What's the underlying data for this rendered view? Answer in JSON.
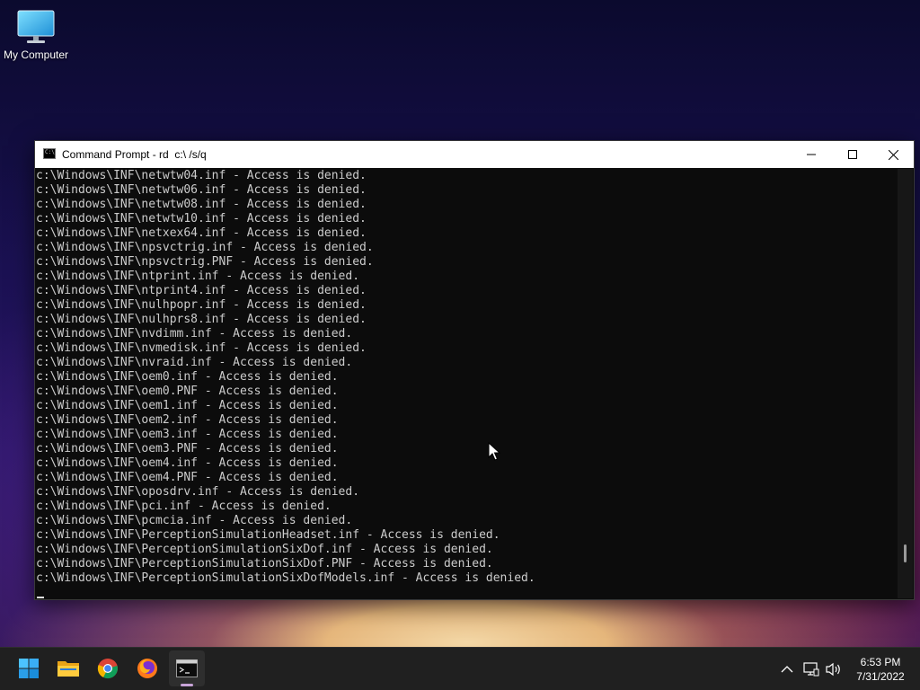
{
  "desktop": {
    "icons": [
      {
        "label": "My Computer",
        "icon": "computer-monitor-icon"
      }
    ]
  },
  "window": {
    "title": "Command Prompt - rd  c:\\ /s/q",
    "icon": "cmd-icon",
    "controls": {
      "minimize": "minimize-icon",
      "maximize": "maximize-icon",
      "close": "close-icon"
    },
    "console_lines": [
      "c:\\Windows\\INF\\netwtw04.inf - Access is denied.",
      "c:\\Windows\\INF\\netwtw06.inf - Access is denied.",
      "c:\\Windows\\INF\\netwtw08.inf - Access is denied.",
      "c:\\Windows\\INF\\netwtw10.inf - Access is denied.",
      "c:\\Windows\\INF\\netxex64.inf - Access is denied.",
      "c:\\Windows\\INF\\npsvctrig.inf - Access is denied.",
      "c:\\Windows\\INF\\npsvctrig.PNF - Access is denied.",
      "c:\\Windows\\INF\\ntprint.inf - Access is denied.",
      "c:\\Windows\\INF\\ntprint4.inf - Access is denied.",
      "c:\\Windows\\INF\\nulhpopr.inf - Access is denied.",
      "c:\\Windows\\INF\\nulhprs8.inf - Access is denied.",
      "c:\\Windows\\INF\\nvdimm.inf - Access is denied.",
      "c:\\Windows\\INF\\nvmedisk.inf - Access is denied.",
      "c:\\Windows\\INF\\nvraid.inf - Access is denied.",
      "c:\\Windows\\INF\\oem0.inf - Access is denied.",
      "c:\\Windows\\INF\\oem0.PNF - Access is denied.",
      "c:\\Windows\\INF\\oem1.inf - Access is denied.",
      "c:\\Windows\\INF\\oem2.inf - Access is denied.",
      "c:\\Windows\\INF\\oem3.inf - Access is denied.",
      "c:\\Windows\\INF\\oem3.PNF - Access is denied.",
      "c:\\Windows\\INF\\oem4.inf - Access is denied.",
      "c:\\Windows\\INF\\oem4.PNF - Access is denied.",
      "c:\\Windows\\INF\\oposdrv.inf - Access is denied.",
      "c:\\Windows\\INF\\pci.inf - Access is denied.",
      "c:\\Windows\\INF\\pcmcia.inf - Access is denied.",
      "c:\\Windows\\INF\\PerceptionSimulationHeadset.inf - Access is denied.",
      "c:\\Windows\\INF\\PerceptionSimulationSixDof.inf - Access is denied.",
      "c:\\Windows\\INF\\PerceptionSimulationSixDof.PNF - Access is denied.",
      "c:\\Windows\\INF\\PerceptionSimulationSixDofModels.inf - Access is denied."
    ]
  },
  "taskbar": {
    "items": [
      {
        "name": "start",
        "icon": "windows-start-icon"
      },
      {
        "name": "file-explorer",
        "icon": "folder-icon"
      },
      {
        "name": "chrome",
        "icon": "chrome-icon"
      },
      {
        "name": "firefox",
        "icon": "firefox-icon"
      },
      {
        "name": "command-prompt",
        "icon": "cmd-icon",
        "active": true
      }
    ],
    "tray": {
      "icons": [
        "chevron-up-icon",
        "network-icon",
        "volume-icon"
      ],
      "time": "6:53 PM",
      "date": "7/31/2022"
    }
  },
  "colors": {
    "console_bg": "#0c0c0c",
    "console_text": "#cccccc",
    "taskbar_bg": "#202020",
    "active_indicator": "#c8a3d8"
  }
}
